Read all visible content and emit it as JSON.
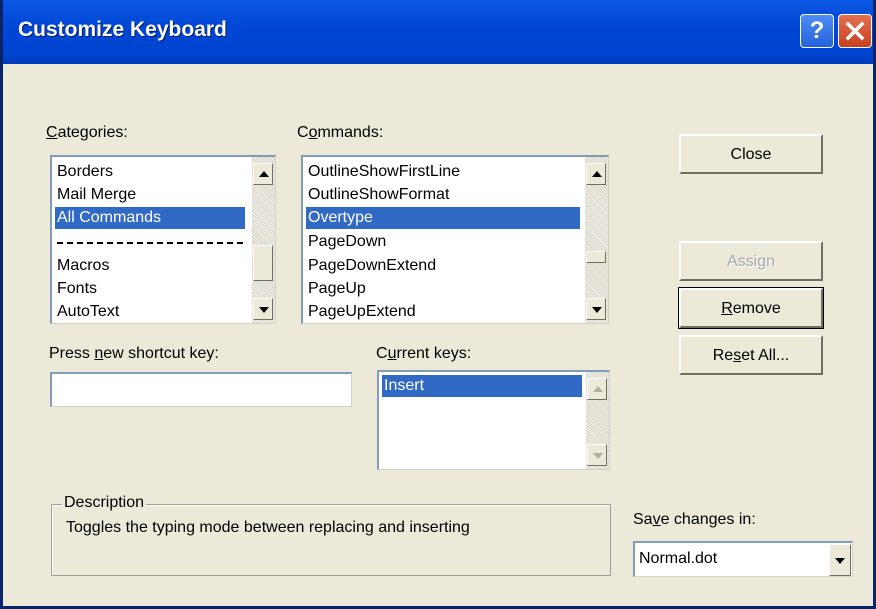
{
  "window": {
    "title": "Customize Keyboard",
    "help_label": "?"
  },
  "categories": {
    "label_pre": "",
    "label_ul": "C",
    "label_post": "ategories:",
    "items": [
      "Borders",
      "Mail Merge",
      "All Commands",
      "Macros",
      "Fonts",
      "AutoText"
    ],
    "selected": "All Commands",
    "separator_after": "All Commands"
  },
  "commands": {
    "label_pre": "C",
    "label_ul": "o",
    "label_post": "mmands:",
    "items": [
      "OutlineShowFirstLine",
      "OutlineShowFormat",
      "Overtype",
      "PageDown",
      "PageDownExtend",
      "PageUp",
      "PageUpExtend"
    ],
    "selected": "Overtype"
  },
  "shortcut": {
    "label_pre": "Press ",
    "label_ul": "n",
    "label_post": "ew shortcut key:",
    "value": ""
  },
  "current_keys": {
    "label_pre": "C",
    "label_ul": "u",
    "label_post": "rrent keys:",
    "items": [
      "Insert"
    ],
    "selected": "Insert"
  },
  "buttons": {
    "close": "Close",
    "assign": "Assign",
    "remove_ul": "R",
    "remove_post": "emove",
    "reset_pre": "Re",
    "reset_ul": "s",
    "reset_post": "et All..."
  },
  "description": {
    "legend": "Description",
    "text": "Toggles the typing mode between replacing and inserting"
  },
  "save": {
    "label_pre": "Sa",
    "label_ul": "v",
    "label_post": "e changes in:",
    "value": "Normal.dot"
  },
  "colors": {
    "titlebar": "#0047D6",
    "selection": "#316AC5",
    "face": "#ECE9D8",
    "close_button": "#C8401E"
  }
}
